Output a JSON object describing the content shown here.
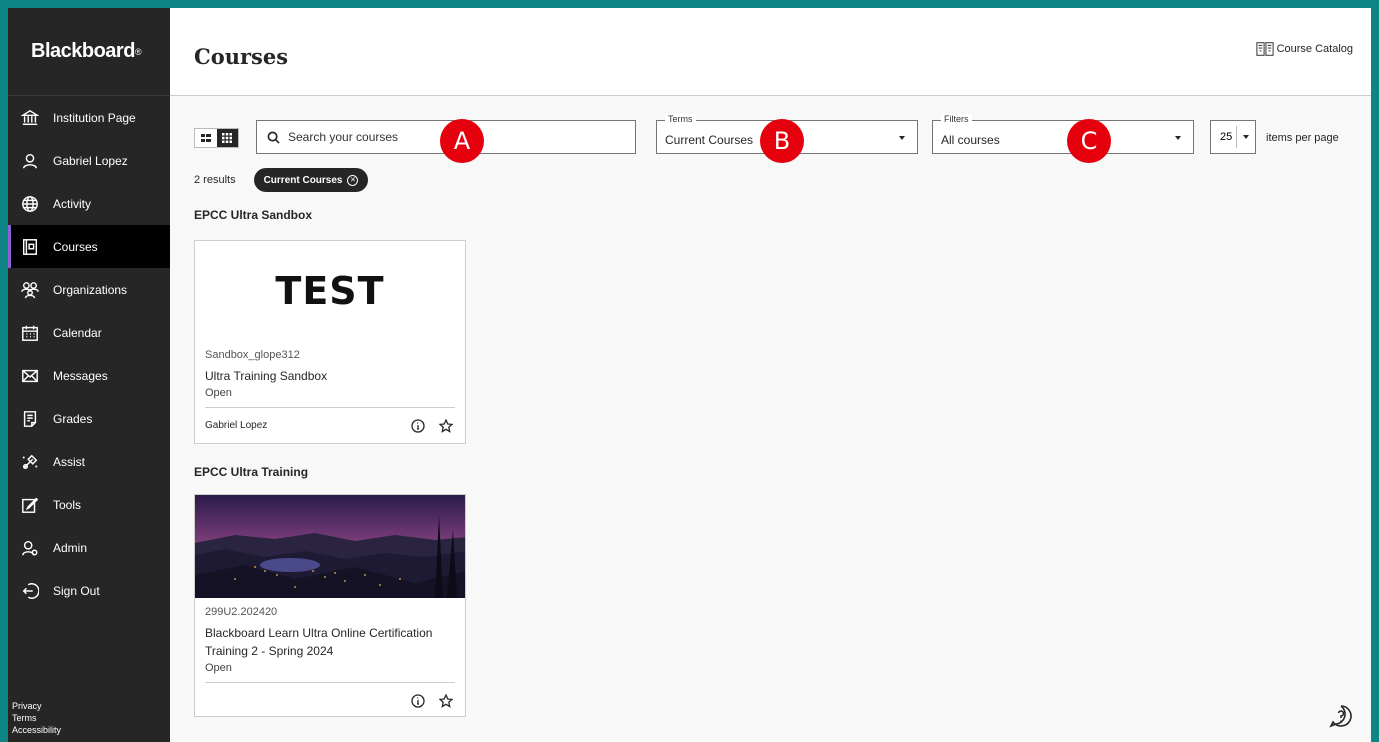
{
  "sidebar": {
    "brand": "Blackboard",
    "brand_mark": "®",
    "items": [
      {
        "label": "Institution Page",
        "icon": "institution-icon"
      },
      {
        "label": "Gabriel Lopez",
        "icon": "user-icon"
      },
      {
        "label": "Activity",
        "icon": "globe-icon"
      },
      {
        "label": "Courses",
        "icon": "courses-icon"
      },
      {
        "label": "Organizations",
        "icon": "organizations-icon"
      },
      {
        "label": "Calendar",
        "icon": "calendar-icon"
      },
      {
        "label": "Messages",
        "icon": "envelope-icon"
      },
      {
        "label": "Grades",
        "icon": "grades-icon"
      },
      {
        "label": "Assist",
        "icon": "assist-icon"
      },
      {
        "label": "Tools",
        "icon": "tools-icon"
      },
      {
        "label": "Admin",
        "icon": "admin-icon"
      },
      {
        "label": "Sign Out",
        "icon": "sign-out-icon"
      }
    ],
    "active": "Courses",
    "footer": [
      "Privacy",
      "Terms",
      "Accessibility"
    ]
  },
  "header": {
    "title": "Courses",
    "catalog_label": "Course Catalog"
  },
  "controls": {
    "search_placeholder": "Search your courses",
    "terms_label": "Terms",
    "terms_value": "Current Courses",
    "filters_label": "Filters",
    "filters_value": "All courses",
    "per_page_value": "25",
    "per_page_label": "items per page"
  },
  "markers": [
    "A",
    "B",
    "C"
  ],
  "results": {
    "count": "2 results",
    "chip": "Current Courses"
  },
  "groups": [
    {
      "title": "EPCC Ultra Sandbox",
      "course": {
        "banner_text": "TEST",
        "id": "Sandbox_glope312",
        "name": "Ultra Training Sandbox",
        "status": "Open",
        "instructor": "Gabriel Lopez"
      }
    },
    {
      "title": "EPCC Ultra Training",
      "course": {
        "id": "299U2.202420",
        "name_line1": "Blackboard Learn Ultra Online Certification",
        "name_line2": "Training 2 - Spring 2024",
        "status": "Open",
        "instructor": ""
      }
    }
  ],
  "colors": {
    "frame": "#0e8585",
    "sidebar": "#262626",
    "active_accent": "#8c62d6",
    "marker": "#e6000e"
  }
}
